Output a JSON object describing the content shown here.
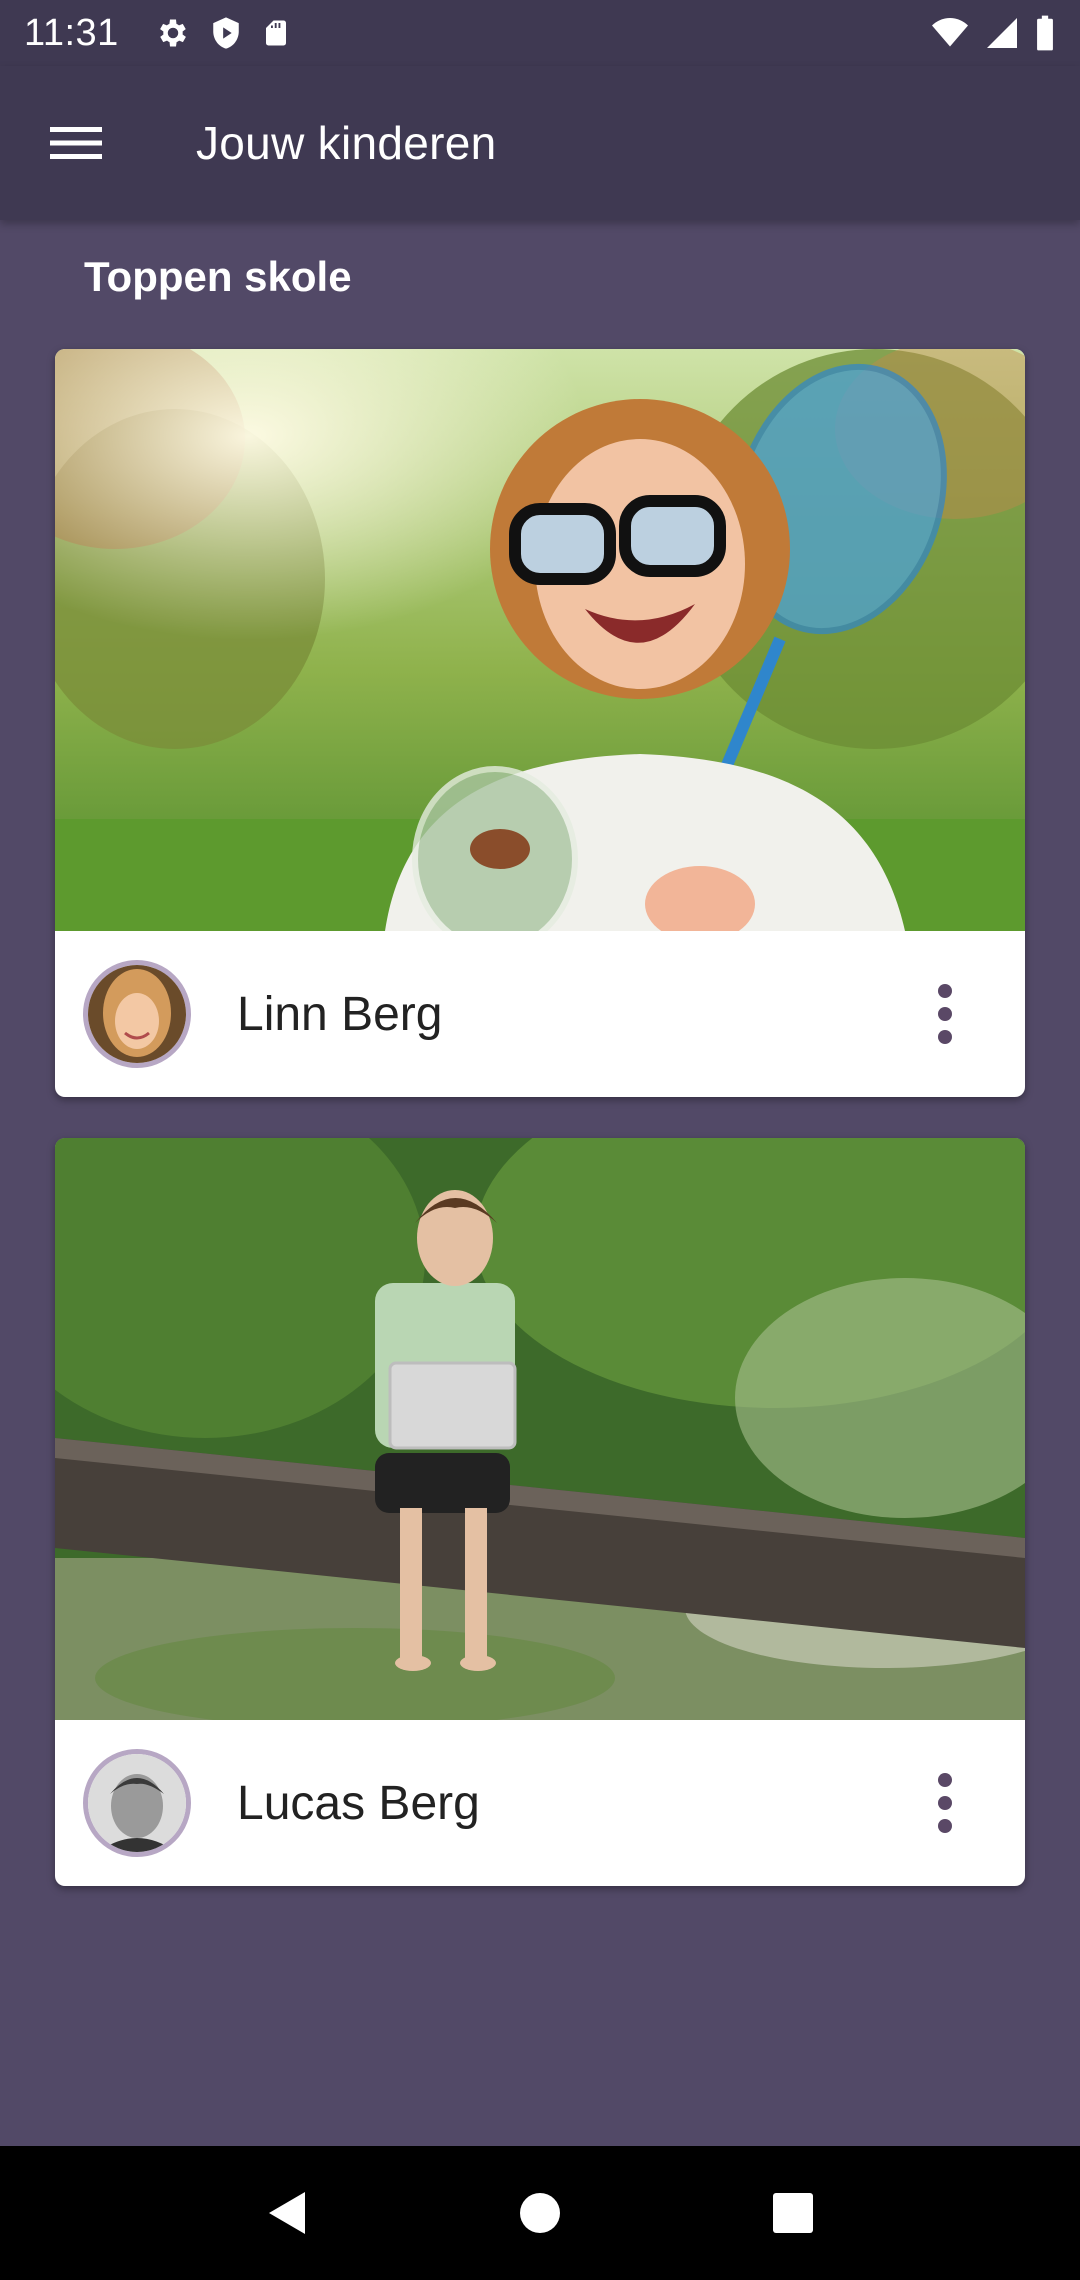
{
  "status_bar": {
    "time": "11:31",
    "left_icons": [
      "gear-icon",
      "shield-play-icon",
      "sd-card-icon"
    ],
    "right_icons": [
      "wifi-icon",
      "cell-signal-icon",
      "battery-icon"
    ]
  },
  "app_bar": {
    "menu_icon": "hamburger-menu-icon",
    "title": "Jouw kinderen"
  },
  "school": {
    "name": "Toppen skole"
  },
  "children": [
    {
      "name": "Linn Berg",
      "cover_description": "girl with glasses holding butterfly net and jar",
      "more_icon": "more-vert-icon"
    },
    {
      "name": "Lucas Berg",
      "cover_description": "boy with laptop sitting on log over stream",
      "more_icon": "more-vert-icon"
    }
  ],
  "nav_bar": {
    "icons": [
      "back-icon",
      "home-icon",
      "recents-icon"
    ]
  },
  "colors": {
    "background": "#524967",
    "app_bar": "#3f3952",
    "card": "#ffffff",
    "accent": "#5a4866"
  }
}
